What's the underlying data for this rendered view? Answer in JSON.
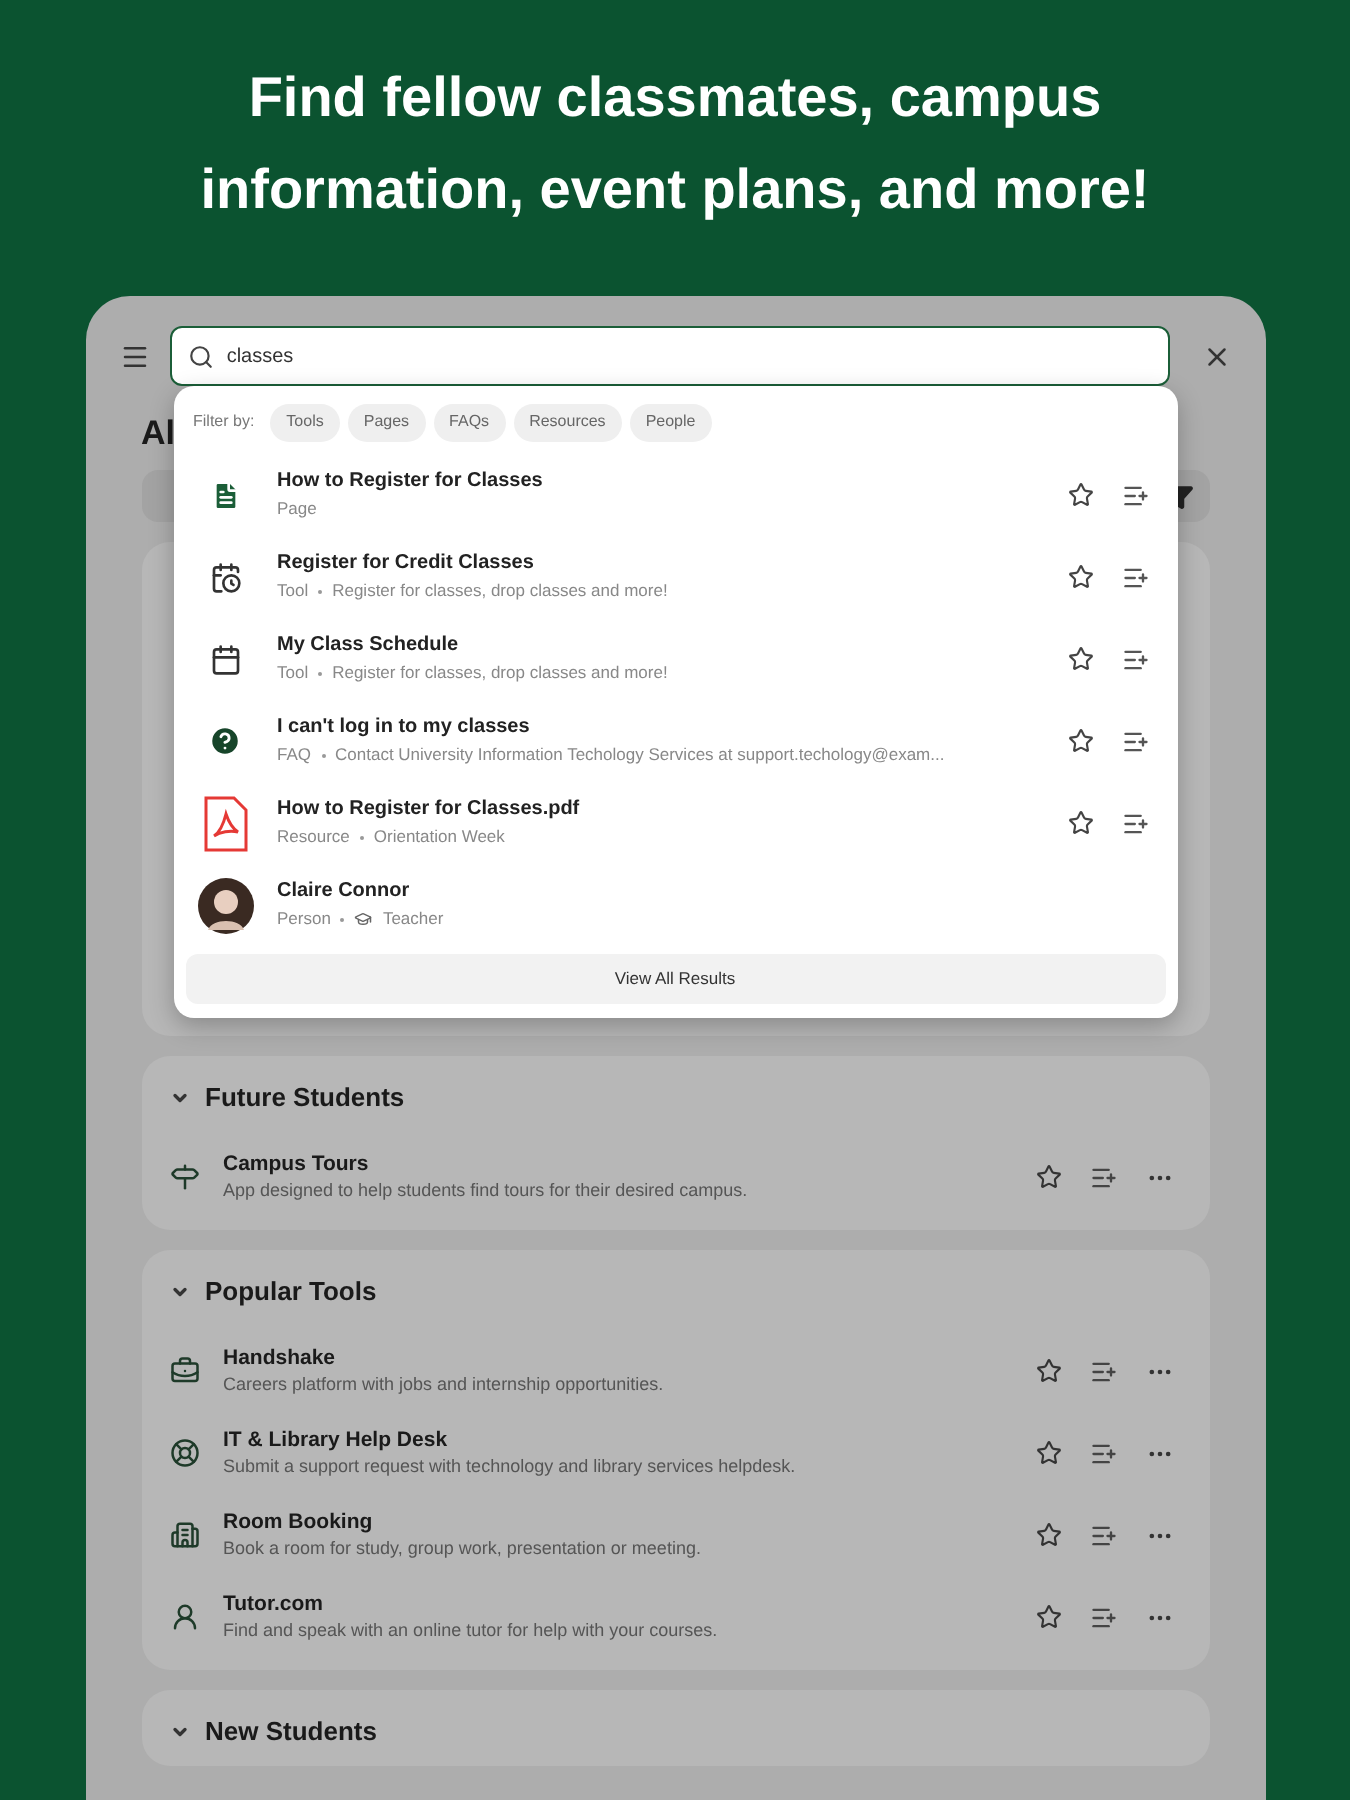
{
  "headline": "Find fellow classmates, campus information, event plans, and more!",
  "search": {
    "value": "classes"
  },
  "page_heading": "Al",
  "dropdown": {
    "filter_label": "Filter by:",
    "filters": [
      {
        "label": "Tools",
        "selected": false
      },
      {
        "label": "Pages",
        "selected": false
      },
      {
        "label": "FAQs",
        "selected": false
      },
      {
        "label": "Resources",
        "selected": false
      },
      {
        "label": "People",
        "selected": false
      }
    ],
    "results": [
      {
        "kind": "page",
        "title": "How to Register for Classes",
        "meta": [
          "Page"
        ]
      },
      {
        "kind": "tool",
        "title": "Register for Credit Classes",
        "meta": [
          "Tool",
          "Register for classes, drop classes and more!"
        ]
      },
      {
        "kind": "schedule",
        "title": "My Class Schedule",
        "meta": [
          "Tool",
          "Register for classes, drop classes and more!"
        ]
      },
      {
        "kind": "faq",
        "title": "I can't log in to my classes",
        "meta": [
          "FAQ",
          "Contact University Information Techology Services at support.techology@exam..."
        ]
      },
      {
        "kind": "pdf",
        "title": "How to Register for Classes.pdf",
        "meta": [
          "Resource",
          "Orientation Week"
        ]
      },
      {
        "kind": "person",
        "title": "Claire Connor",
        "meta": [
          "Person",
          "Teacher"
        ]
      }
    ],
    "view_all": "View All Results"
  },
  "sections": [
    {
      "title": "Future Students",
      "expanded": true,
      "items": [
        {
          "title": "Campus Tours",
          "description": "App designed to help students find tours for their desired campus."
        }
      ]
    },
    {
      "title": "Popular Tools",
      "expanded": true,
      "items": [
        {
          "title": "Handshake",
          "description": "Careers platform with jobs and internship opportunities."
        },
        {
          "title": "IT & Library Help Desk",
          "description": "Submit a support request with technology and library services helpdesk."
        },
        {
          "title": "Room Booking",
          "description": "Book a room for study, group work, presentation or meeting."
        },
        {
          "title": "Tutor.com",
          "description": "Find and speak with an online tutor for help with your courses."
        }
      ]
    },
    {
      "title": "New Students",
      "expanded": true
    }
  ]
}
